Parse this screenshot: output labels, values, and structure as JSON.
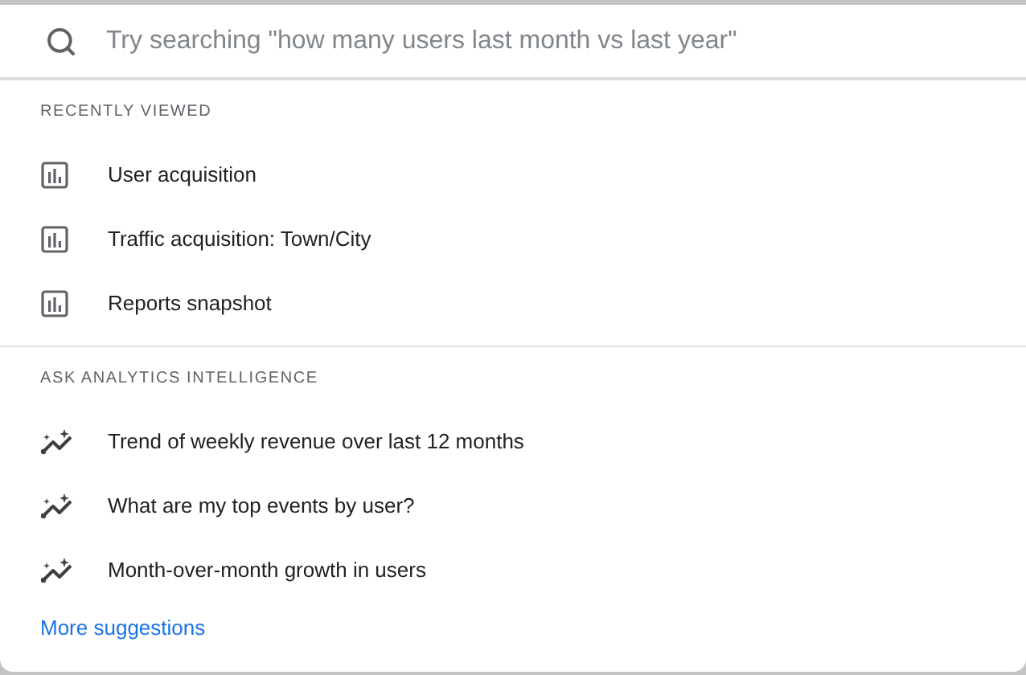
{
  "search": {
    "placeholder": "Try searching \"how many users last month vs last year\""
  },
  "sections": [
    {
      "heading": "RECENTLY VIEWED",
      "items": [
        {
          "kind": "report",
          "label": "User acquisition"
        },
        {
          "kind": "report",
          "label": "Traffic acquisition: Town/City"
        },
        {
          "kind": "report",
          "label": "Reports snapshot"
        }
      ]
    },
    {
      "heading": "ASK ANALYTICS INTELLIGENCE",
      "items": [
        {
          "kind": "insight",
          "label": "Trend of weekly revenue over last 12 months"
        },
        {
          "kind": "insight",
          "label": "What are my top events by user?"
        },
        {
          "kind": "insight",
          "label": "Month-over-month growth in users"
        }
      ],
      "link": "More suggestions"
    }
  ]
}
